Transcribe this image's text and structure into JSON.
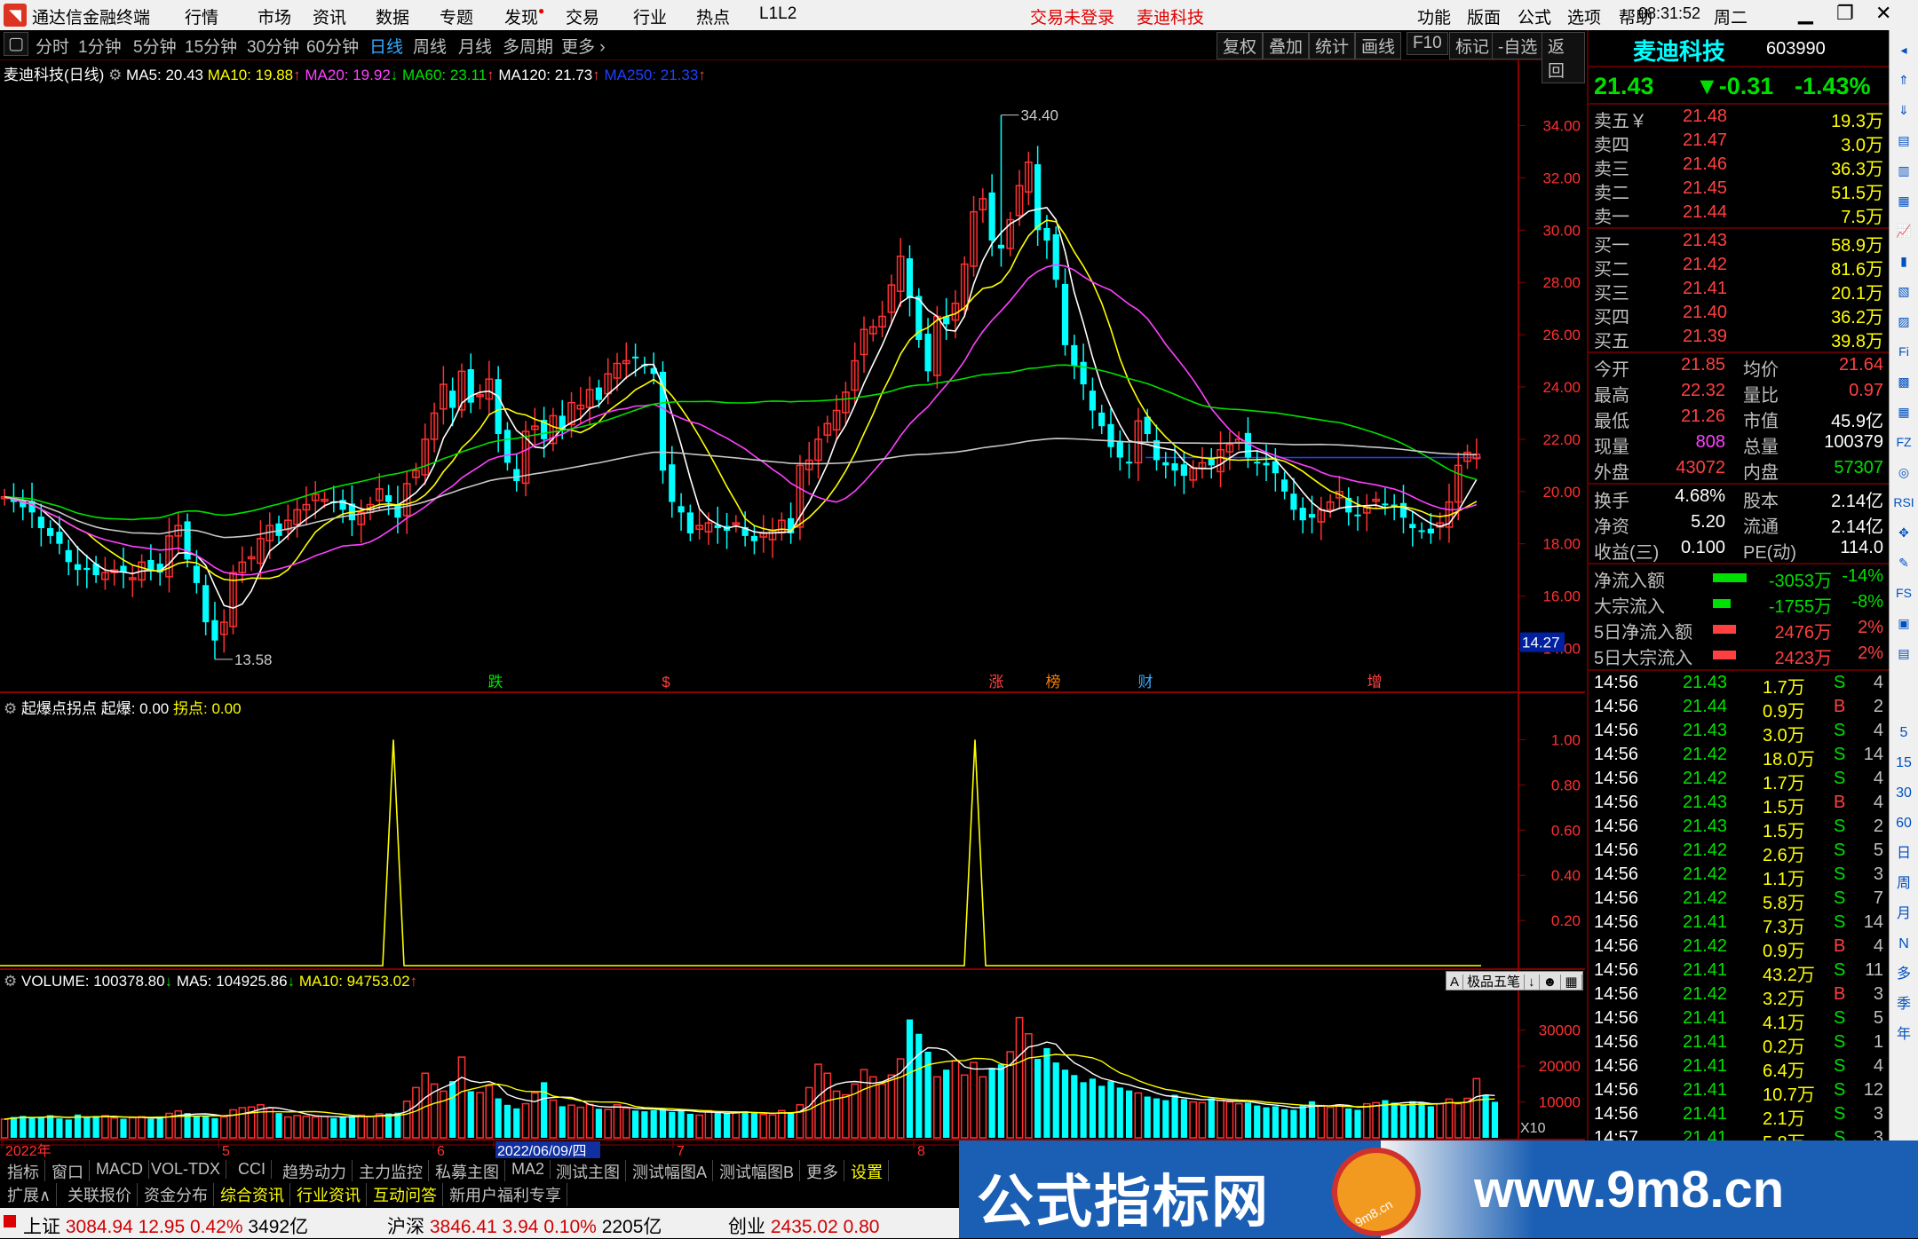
{
  "app": {
    "title": "通达信金融终端",
    "menus": [
      "行情",
      "市场",
      "资讯",
      "数据",
      "专题",
      "发现",
      "交易",
      "行业",
      "热点",
      "L1L2"
    ],
    "login": "交易未登录",
    "stock_tab": "麦迪科技",
    "right_menus": [
      "功能",
      "版面",
      "公式",
      "选项",
      "帮助"
    ],
    "time": "08:31:52",
    "weekday": "周二"
  },
  "periods": [
    "分时",
    "1分钟",
    "5分钟",
    "15分钟",
    "30分钟",
    "60分钟",
    "日线",
    "周线",
    "月线",
    "多周期",
    "更多"
  ],
  "selected_period": "日线",
  "tools": [
    "复权",
    "叠加",
    "统计",
    "画线",
    "F10",
    "标记",
    "-自选",
    "返回"
  ],
  "main_legend": {
    "name": "麦迪科技(日线)",
    "ma5": "MA5: 20.43",
    "ma10": "MA10: 19.88",
    "ma20": "MA20: 19.92",
    "ma60": "MA60: 23.11",
    "ma120": "MA120: 21.73",
    "ma250": "MA250: 21.33"
  },
  "price_axis": [
    "34.00",
    "32.00",
    "30.00",
    "28.00",
    "26.00",
    "24.00",
    "22.00",
    "20.00",
    "18.00",
    "16.00",
    "14.00"
  ],
  "price_now_tag": "14.27",
  "high_label": "34.40",
  "low_label": "13.58",
  "event_markers": [
    {
      "label": "跌",
      "color": "#00e000"
    },
    {
      "label": "$",
      "color": "#ff4040"
    },
    {
      "label": "涨",
      "color": "#ff4040"
    },
    {
      "label": "榜",
      "color": "#ff8000"
    },
    {
      "label": "财",
      "color": "#3af"
    },
    {
      "label": "增",
      "color": "#ff4040"
    }
  ],
  "ind1_legend": {
    "name": "起爆点拐点",
    "v1": "起爆: 0.00",
    "v2": "拐点: 0.00"
  },
  "ind1_axis": [
    "1.00",
    "0.80",
    "0.60",
    "0.40",
    "0.20"
  ],
  "vol_legend": {
    "name": "VOLUME: 100378.80",
    "ma5": "MA5: 104925.86",
    "ma10": "MA10: 94753.02"
  },
  "vol_axis": [
    "30000",
    "20000",
    "10000"
  ],
  "vol_unit": "X10",
  "vol_buttons": [
    "A",
    "极品五笔",
    "↓",
    "☻",
    "▦"
  ],
  "date_axis": [
    "2022年",
    "5",
    "6",
    "2022/06/09/四",
    "7",
    "8"
  ],
  "chart_data": [
    {
      "type": "candlestick",
      "title": "麦迪科技(日线)",
      "ylim": [
        13.0,
        35.0
      ],
      "yticks": [
        14,
        16,
        18,
        20,
        22,
        24,
        26,
        28,
        30,
        32,
        34
      ],
      "high": 34.4,
      "low": 13.58,
      "close": [
        19.8,
        19.6,
        19.4,
        19.2,
        18.6,
        18.3,
        18.0,
        17.3,
        17.0,
        17.0,
        16.8,
        16.9,
        17.0,
        16.9,
        16.7,
        17.3,
        17.0,
        16.9,
        18.3,
        18.7,
        17.4,
        16.5,
        15.0,
        14.3,
        15.0,
        16.9,
        17.3,
        17.5,
        18.2,
        18.7,
        18.3,
        18.9,
        19.3,
        19.5,
        19.9,
        19.7,
        19.6,
        19.3,
        18.9,
        19.2,
        19.5,
        20.1,
        19.6,
        19.0,
        20.3,
        20.8,
        22.0,
        23.0,
        24.1,
        23.2,
        24.6,
        23.4,
        23.7,
        24.3,
        22.2,
        21.1,
        20.4,
        22.3,
        22.5,
        22.0,
        22.9,
        22.4,
        23.4,
        23.3,
        23.9,
        23.5,
        24.5,
        24.9,
        25.0,
        25.1,
        24.8,
        24.5,
        20.8,
        19.6,
        19.2,
        18.4,
        18.7,
        18.8,
        18.6,
        18.5,
        18.8,
        18.3,
        18.1,
        18.4,
        18.5,
        18.9,
        18.4,
        21.0,
        21.2,
        22.0,
        22.6,
        23.1,
        23.8,
        25.0,
        26.2,
        26.3,
        26.7,
        27.9,
        29.0,
        27.4,
        25.8,
        24.6,
        26.7,
        26.4,
        27.2,
        28.7,
        30.7,
        31.2,
        29.6,
        29.3,
        30.4,
        31.7,
        32.6,
        30.0,
        29.6,
        28.1,
        25.6,
        24.8,
        24.1,
        23.1,
        22.5,
        21.7,
        21.3,
        21.1,
        22.7,
        22.2,
        21.2,
        21.0,
        20.8,
        20.6,
        20.9,
        21.1,
        21.0,
        21.6,
        21.8,
        22.0,
        21.3,
        21.1,
        21.0,
        20.7,
        20.0,
        19.3,
        18.9,
        19.0,
        19.3,
        19.6,
        20.0,
        19.2,
        19.1,
        19.4,
        19.7,
        19.5,
        19.4,
        19.0,
        18.6,
        18.5,
        18.4,
        18.8,
        19.6,
        21.0,
        21.5,
        21.43
      ]
    },
    {
      "type": "line",
      "title": "起爆点拐点",
      "ylim": [
        0,
        1.1
      ],
      "series": [
        {
          "name": "起爆",
          "peaks_at_index": [
            50,
            120
          ],
          "values_peak": 1.0
        }
      ]
    },
    {
      "type": "bar",
      "title": "VOLUME",
      "ylim": [
        0,
        40000
      ],
      "yticks": [
        10000,
        20000,
        30000
      ],
      "values": [
        5200,
        5800,
        6100,
        5600,
        5900,
        6300,
        5400,
        5100,
        6500,
        5800,
        6100,
        6200,
        5500,
        5300,
        5600,
        5900,
        5300,
        5700,
        6800,
        7500,
        6900,
        6200,
        6000,
        5500,
        5800,
        7800,
        8400,
        8600,
        9200,
        8300,
        6900,
        5800,
        6200,
        6000,
        5800,
        6000,
        5500,
        5900,
        6100,
        6300,
        5900,
        6700,
        6800,
        7000,
        10200,
        14000,
        18000,
        15000,
        13000,
        15800,
        22500,
        13000,
        12600,
        14500,
        11000,
        9200,
        8200,
        9500,
        12500,
        15500,
        10500,
        8800,
        9100,
        8500,
        9300,
        8100,
        7900,
        9200,
        8300,
        7600,
        7400,
        7700,
        8100,
        7200,
        7900,
        6700,
        6300,
        7600,
        7000,
        6800,
        7000,
        7400,
        6900,
        6500,
        6400,
        7600,
        6900,
        9200,
        14000,
        20500,
        18000,
        13000,
        12000,
        15000,
        19000,
        17000,
        15000,
        17500,
        22000,
        33000,
        29000,
        24000,
        17000,
        19000,
        21500,
        17500,
        21000,
        17000,
        19500,
        20500,
        24000,
        33500,
        29000,
        22000,
        25000,
        21000,
        19000,
        17500,
        15500,
        16500,
        14500,
        15800,
        14000,
        13200,
        12500,
        11500,
        11000,
        10500,
        12000,
        10800,
        10000,
        9800,
        11000,
        10500,
        10000,
        9500,
        9800,
        9000,
        8500,
        8800,
        8000,
        7800,
        9200,
        10200,
        9000,
        8500,
        9200,
        8200,
        7800,
        9500,
        9800,
        10500,
        9800,
        9200,
        10200,
        9800,
        8800,
        9500,
        10800,
        9500,
        11000,
        16500,
        12000,
        10037.88
      ]
    }
  ],
  "quote": {
    "name": "麦迪科技",
    "code": "603990",
    "price": "21.43",
    "change": "▼-0.31",
    "pct": "-1.43%",
    "asks": [
      {
        "label": "卖五￥",
        "p": "21.48",
        "v": "19.3万"
      },
      {
        "label": "卖四",
        "p": "21.47",
        "v": "3.0万"
      },
      {
        "label": "卖三",
        "p": "21.46",
        "v": "36.3万"
      },
      {
        "label": "卖二",
        "p": "21.45",
        "v": "51.5万"
      },
      {
        "label": "卖一",
        "p": "21.44",
        "v": "7.5万"
      }
    ],
    "bids": [
      {
        "label": "买一",
        "p": "21.43",
        "v": "58.9万"
      },
      {
        "label": "买二",
        "p": "21.42",
        "v": "81.6万"
      },
      {
        "label": "买三",
        "p": "21.41",
        "v": "20.1万"
      },
      {
        "label": "买四",
        "p": "21.40",
        "v": "36.2万"
      },
      {
        "label": "买五",
        "p": "21.39",
        "v": "39.8万"
      }
    ],
    "stats": [
      {
        "k1": "今开",
        "v1": "21.85",
        "c1": "red",
        "k2": "均价",
        "v2": "21.64",
        "c2": "red"
      },
      {
        "k1": "最高",
        "v1": "22.32",
        "c1": "red",
        "k2": "量比",
        "v2": "0.97",
        "c2": "red"
      },
      {
        "k1": "最低",
        "v1": "21.26",
        "c1": "red",
        "k2": "市值",
        "v2": "45.9亿",
        "c2": "white"
      },
      {
        "k1": "现量",
        "v1": "808",
        "c1": "mag",
        "k2": "总量",
        "v2": "100379",
        "c2": "white"
      },
      {
        "k1": "外盘",
        "v1": "43072",
        "c1": "red",
        "k2": "内盘",
        "v2": "57307",
        "c2": "green"
      }
    ],
    "stats2": [
      {
        "k1": "换手",
        "v1": "4.68%",
        "k2": "股本",
        "v2": "2.14亿"
      },
      {
        "k1": "净资",
        "v1": "5.20",
        "k2": "流通",
        "v2": "2.14亿"
      },
      {
        "k1": "收益(三)",
        "v1": "0.100",
        "k2": "PE(动)",
        "v2": "114.0"
      }
    ],
    "flows": [
      {
        "label": "净流入额",
        "v": "-3053万",
        "pct": "-14%",
        "color": "#00e000"
      },
      {
        "label": "大宗流入",
        "v": "-1755万",
        "pct": "-8%",
        "color": "#00e000"
      },
      {
        "label": "5日净流入额",
        "v": "2476万",
        "pct": "2%",
        "color": "#ff4040"
      },
      {
        "label": "5日大宗流入",
        "v": "2423万",
        "pct": "2%",
        "color": "#ff4040"
      }
    ]
  },
  "ticks": [
    {
      "t": "14:56",
      "p": "21.43",
      "v": "1.7万",
      "s": "S",
      "n": "4"
    },
    {
      "t": "14:56",
      "p": "21.44",
      "v": "0.9万",
      "s": "B",
      "n": "2"
    },
    {
      "t": "14:56",
      "p": "21.43",
      "v": "3.0万",
      "s": "S",
      "n": "4"
    },
    {
      "t": "14:56",
      "p": "21.42",
      "v": "18.0万",
      "s": "S",
      "n": "14"
    },
    {
      "t": "14:56",
      "p": "21.42",
      "v": "1.7万",
      "s": "S",
      "n": "4"
    },
    {
      "t": "14:56",
      "p": "21.43",
      "v": "1.5万",
      "s": "B",
      "n": "4"
    },
    {
      "t": "14:56",
      "p": "21.43",
      "v": "1.5万",
      "s": "S",
      "n": "2"
    },
    {
      "t": "14:56",
      "p": "21.42",
      "v": "2.6万",
      "s": "S",
      "n": "5"
    },
    {
      "t": "14:56",
      "p": "21.42",
      "v": "1.1万",
      "s": "S",
      "n": "3"
    },
    {
      "t": "14:56",
      "p": "21.42",
      "v": "5.8万",
      "s": "S",
      "n": "7"
    },
    {
      "t": "14:56",
      "p": "21.41",
      "v": "7.3万",
      "s": "S",
      "n": "14"
    },
    {
      "t": "14:56",
      "p": "21.42",
      "v": "0.9万",
      "s": "B",
      "n": "4"
    },
    {
      "t": "14:56",
      "p": "21.41",
      "v": "43.2万",
      "s": "S",
      "n": "11"
    },
    {
      "t": "14:56",
      "p": "21.42",
      "v": "3.2万",
      "s": "B",
      "n": "3"
    },
    {
      "t": "14:56",
      "p": "21.41",
      "v": "4.1万",
      "s": "S",
      "n": "5"
    },
    {
      "t": "14:56",
      "p": "21.41",
      "v": "0.2万",
      "s": "S",
      "n": "1"
    },
    {
      "t": "14:56",
      "p": "21.41",
      "v": "6.4万",
      "s": "S",
      "n": "4"
    },
    {
      "t": "14:56",
      "p": "21.41",
      "v": "10.7万",
      "s": "S",
      "n": "12"
    },
    {
      "t": "14:56",
      "p": "21.41",
      "v": "2.1万",
      "s": "S",
      "n": "3"
    },
    {
      "t": "14:57",
      "p": "21.41",
      "v": "5.8万",
      "s": "S",
      "n": "3"
    }
  ],
  "sidebar_labels": [
    "5",
    "15",
    "30",
    "60",
    "日",
    "周",
    "月",
    "N",
    "多",
    "季",
    "年"
  ],
  "bottom_tabs1": [
    "指标",
    "窗口",
    "MACD",
    "VOL-TDX",
    "CCI",
    "趋势动力",
    "主力监控",
    "私募主图",
    "MA2",
    "测试主图",
    "测试幅图A",
    "测试幅图B",
    "更多",
    "设置"
  ],
  "bottom_tabs2": [
    "扩展∧",
    "关联报价",
    "资金分布",
    "综合资讯",
    "行业资讯",
    "互动问答",
    "新用户福利专享"
  ],
  "status": [
    {
      "name": "上证",
      "v": "3084.94",
      "c": "12.95",
      "p": "0.42%",
      "amt": "3492亿"
    },
    {
      "name": "沪深",
      "v": "3846.41",
      "c": "3.94",
      "p": "0.10%",
      "amt": "2205亿"
    },
    {
      "name": "创业",
      "v": "2435.02",
      "c": "0.80"
    }
  ],
  "watermark": {
    "text": "公式指标网",
    "url": "www.9m8.cn",
    "badge": "9m8.cn"
  }
}
